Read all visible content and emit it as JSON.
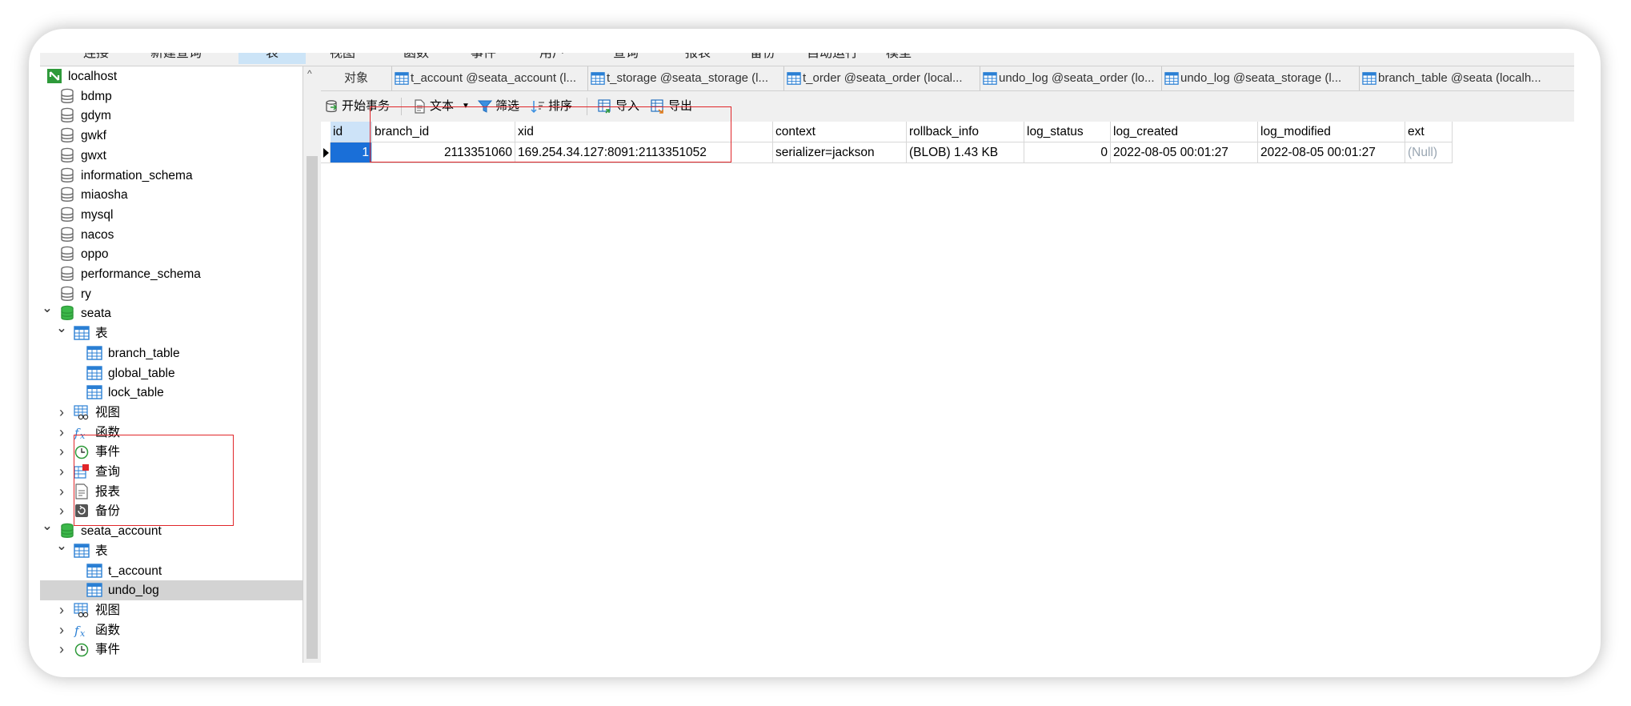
{
  "menubar": {
    "items": [
      "连接",
      "新建查询",
      "表",
      "视图",
      "函数",
      "事件",
      "用户",
      "查询",
      "报表",
      "备份",
      "自动运行",
      "模型"
    ],
    "active_index": 2
  },
  "sidebar": {
    "connection": "localhost",
    "databases_top": [
      "bdmp",
      "gdym",
      "gwkf",
      "gwxt",
      "information_schema",
      "miaosha",
      "mysql",
      "nacos",
      "oppo",
      "performance_schema",
      "ry"
    ],
    "seata": {
      "name": "seata",
      "tables_label": "表",
      "tables": [
        "branch_table",
        "global_table",
        "lock_table"
      ],
      "groups": [
        "视图",
        "函数",
        "事件",
        "查询",
        "报表",
        "备份"
      ]
    },
    "seata_account": {
      "name": "seata_account",
      "tables_label": "表",
      "tables": [
        "t_account",
        "undo_log"
      ],
      "selected_table": "undo_log",
      "groups": [
        "视图",
        "函数",
        "事件"
      ]
    }
  },
  "tabs": [
    "对象",
    "t_account @seata_account (l...",
    "t_storage @seata_storage (l...",
    "t_order @seata_order (local...",
    "undo_log @seata_order (lo...",
    "undo_log @seata_storage (l...",
    "branch_table @seata (localh..."
  ],
  "toolbar": {
    "begin_transaction": "开始事务",
    "text": "文本",
    "filter": "筛选",
    "sort": "排序",
    "import": "导入",
    "export": "导出"
  },
  "grid": {
    "columns": [
      "id",
      "branch_id",
      "xid",
      "context",
      "rollback_info",
      "log_status",
      "log_created",
      "log_modified",
      "ext"
    ],
    "rows": [
      [
        "1",
        "2113351060",
        "169.254.34.127:8091:2113351052",
        "serializer=jackson",
        "(BLOB) 1.43 KB",
        "0",
        "2022-08-05 00:01:27",
        "2022-08-05 00:01:27",
        "(Null)"
      ]
    ]
  },
  "colors": {
    "annotation_red": "#e0262a",
    "selection_blue": "#1a6fd8",
    "db_green": "#2e9a3a"
  },
  "icons": {
    "connection": "connection-icon",
    "database": "database-icon",
    "table": "table-icon",
    "view": "view-icon",
    "function": "function-icon",
    "event": "event-icon",
    "query": "query-icon",
    "report": "report-icon",
    "backup": "backup-icon"
  }
}
